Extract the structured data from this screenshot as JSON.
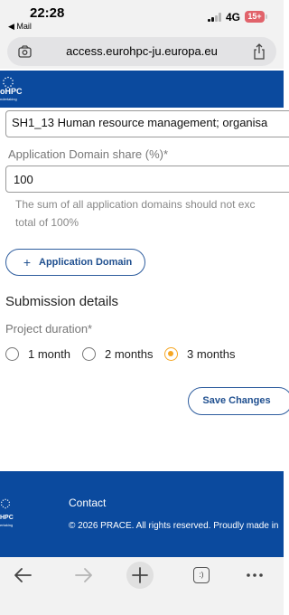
{
  "status_bar": {
    "time": "22:28",
    "back_app": "◀ Mail",
    "network": "4G",
    "battery": "15+"
  },
  "address_bar": {
    "url": "access.eurohpc-ju.europa.eu"
  },
  "site_header": {
    "logo_name": "oHPC",
    "logo_sub": "ndertaking"
  },
  "form": {
    "research_field_value": "SH1_13 Human resource management; organisa",
    "app_domain_share_label": "Application Domain share (%)*",
    "app_domain_share_value": "100",
    "hint_line1": "The sum of all application domains should not exc",
    "hint_line2": "total of 100%",
    "add_domain_button": "Application Domain",
    "add_domain_plus": "+"
  },
  "submission": {
    "title": "Submission details",
    "duration_label": "Project duration*",
    "options": [
      {
        "label": "1 month",
        "selected": false
      },
      {
        "label": "2 months",
        "selected": false
      },
      {
        "label": "3 months",
        "selected": true
      }
    ],
    "save_button": "Save Changes"
  },
  "footer": {
    "logo_name": "HPC",
    "logo_sub": "ertaking",
    "contact": "Contact",
    "copyright": "© 2026 PRACE. All rights reserved. Proudly made in"
  },
  "toolbar": {
    "tab_count": ":)"
  },
  "colors": {
    "brand_blue": "#0b4a9e",
    "button_blue": "#1f4f8f",
    "radio_selected": "#f5a623"
  }
}
